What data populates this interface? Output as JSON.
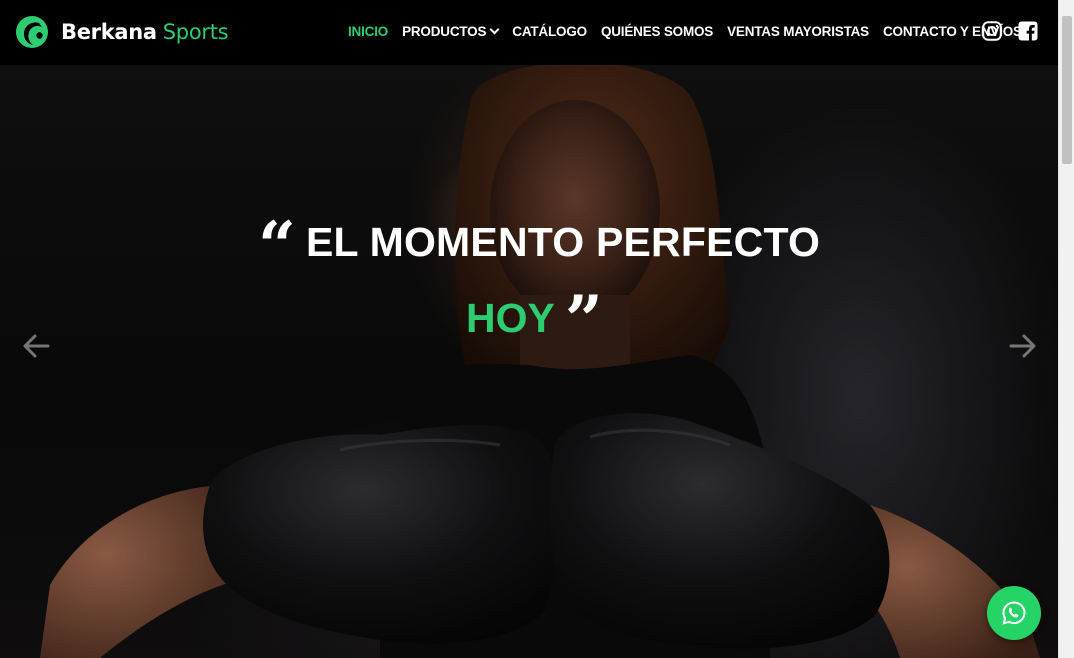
{
  "brand": {
    "name_part1": "Berkana",
    "name_part2": "Sports",
    "logo_icon": "crescent-leaf-logo"
  },
  "nav": {
    "items": [
      {
        "label": "INICIO",
        "active": true
      },
      {
        "label": "PRODUCTOS",
        "active": false,
        "has_dropdown": true
      },
      {
        "label": "CATÁLOGO",
        "active": false
      },
      {
        "label": "QUIÉNES SOMOS",
        "active": false
      },
      {
        "label": "VENTAS MAYORISTAS",
        "active": false
      },
      {
        "label": "CONTACTO Y ENVÍOS",
        "active": false
      }
    ],
    "social_icons": [
      "instagram-icon",
      "facebook-icon"
    ]
  },
  "hero": {
    "headline": "EL MOMENTO PERFECTO",
    "headline_accent": "HOY",
    "open_quote": "“",
    "close_quote": "”",
    "prev_icon": "arrow-left-icon",
    "next_icon": "arrow-right-icon"
  },
  "floating": {
    "whatsapp_icon": "whatsapp-icon"
  },
  "colors": {
    "accent": "#2ecc71",
    "header_bg": "#000000",
    "whatsapp": "#25d366",
    "text": "#ffffff"
  }
}
